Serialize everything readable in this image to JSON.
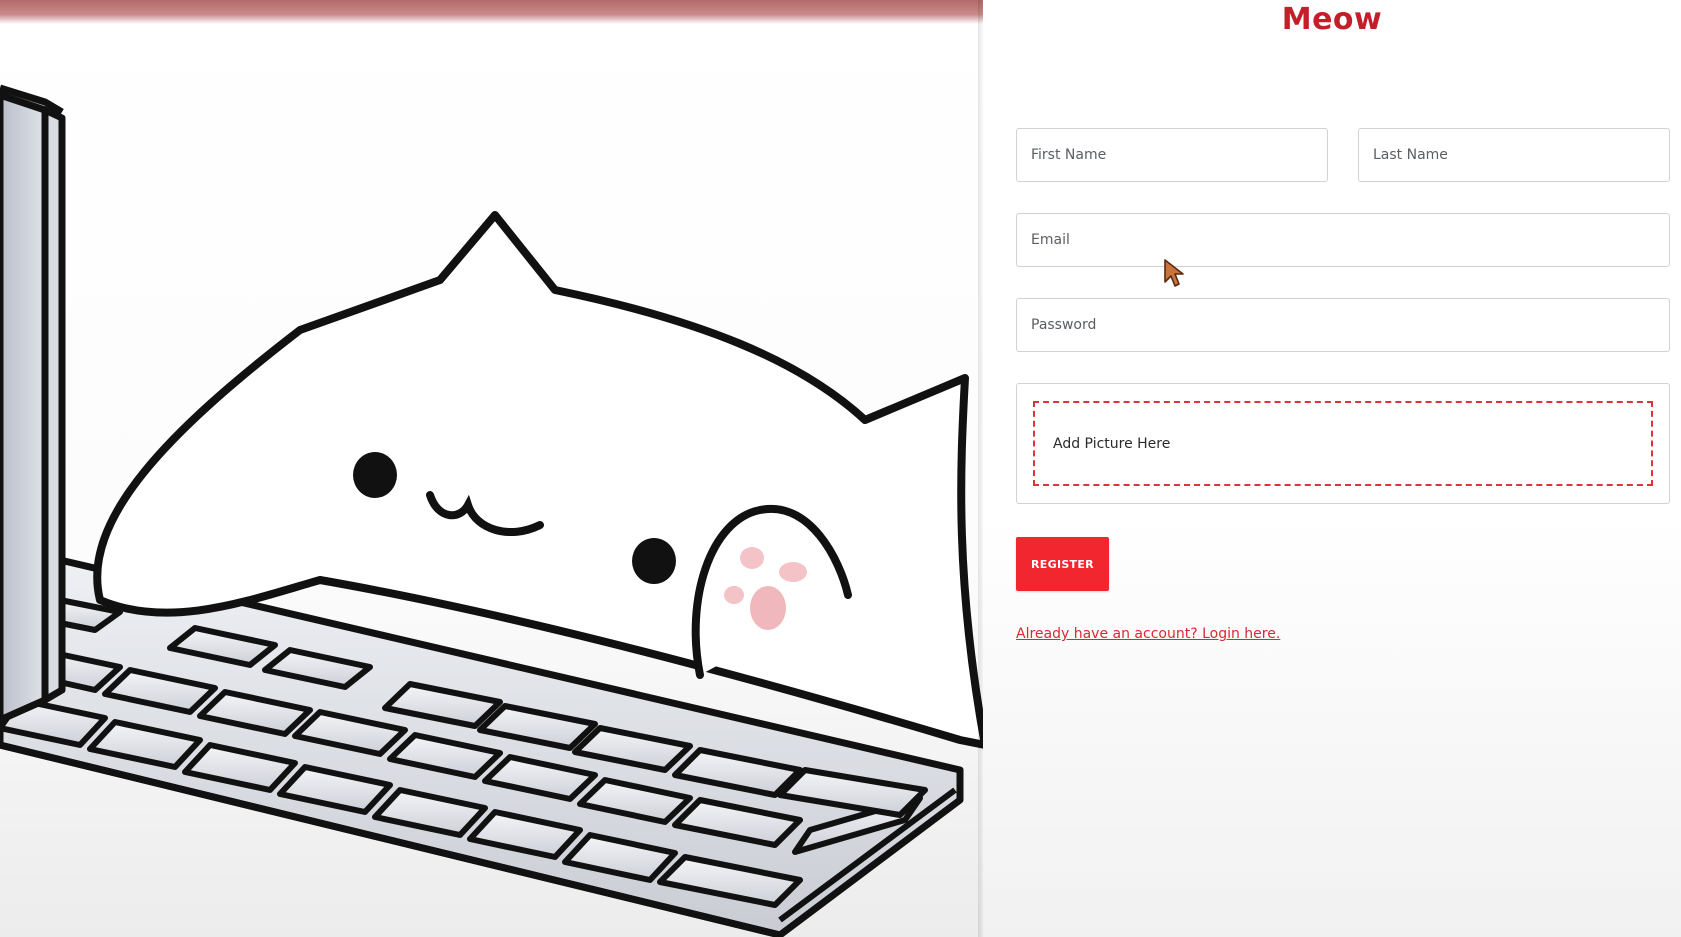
{
  "brand": {
    "title": "Meow",
    "accent_color": "#c21f2a"
  },
  "hero": {
    "illustration": "cat-at-keyboard-illustration"
  },
  "form": {
    "first_name_placeholder": "First Name",
    "last_name_placeholder": "Last Name",
    "email_placeholder": "Email",
    "password_placeholder": "Password",
    "upload_label": "Add Picture Here",
    "register_label": "REGISTER",
    "login_link_text": "Already have an account? Login here.",
    "button_color": "#f1262e",
    "dashed_border_color": "#e0323c"
  },
  "cursor": {
    "icon": "mouse-pointer-icon"
  }
}
